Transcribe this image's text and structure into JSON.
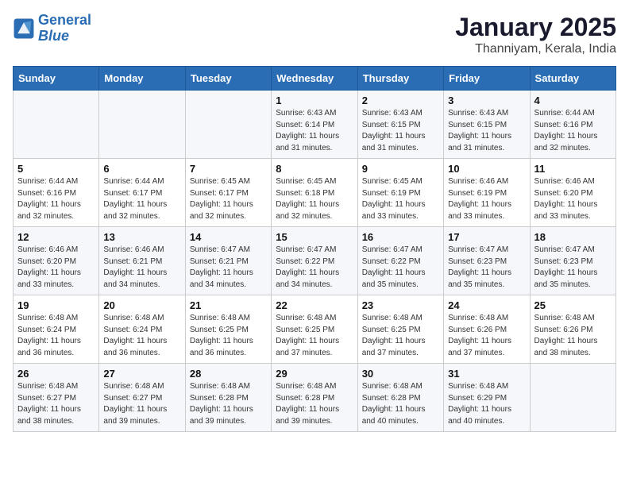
{
  "logo": {
    "line1": "General",
    "line2": "Blue"
  },
  "title": "January 2025",
  "subtitle": "Thanniyam, Kerala, India",
  "days_of_week": [
    "Sunday",
    "Monday",
    "Tuesday",
    "Wednesday",
    "Thursday",
    "Friday",
    "Saturday"
  ],
  "weeks": [
    [
      {
        "day": "",
        "sunrise": "",
        "sunset": "",
        "daylight": ""
      },
      {
        "day": "",
        "sunrise": "",
        "sunset": "",
        "daylight": ""
      },
      {
        "day": "",
        "sunrise": "",
        "sunset": "",
        "daylight": ""
      },
      {
        "day": "1",
        "sunrise": "Sunrise: 6:43 AM",
        "sunset": "Sunset: 6:14 PM",
        "daylight": "Daylight: 11 hours and 31 minutes."
      },
      {
        "day": "2",
        "sunrise": "Sunrise: 6:43 AM",
        "sunset": "Sunset: 6:15 PM",
        "daylight": "Daylight: 11 hours and 31 minutes."
      },
      {
        "day": "3",
        "sunrise": "Sunrise: 6:43 AM",
        "sunset": "Sunset: 6:15 PM",
        "daylight": "Daylight: 11 hours and 31 minutes."
      },
      {
        "day": "4",
        "sunrise": "Sunrise: 6:44 AM",
        "sunset": "Sunset: 6:16 PM",
        "daylight": "Daylight: 11 hours and 32 minutes."
      }
    ],
    [
      {
        "day": "5",
        "sunrise": "Sunrise: 6:44 AM",
        "sunset": "Sunset: 6:16 PM",
        "daylight": "Daylight: 11 hours and 32 minutes."
      },
      {
        "day": "6",
        "sunrise": "Sunrise: 6:44 AM",
        "sunset": "Sunset: 6:17 PM",
        "daylight": "Daylight: 11 hours and 32 minutes."
      },
      {
        "day": "7",
        "sunrise": "Sunrise: 6:45 AM",
        "sunset": "Sunset: 6:17 PM",
        "daylight": "Daylight: 11 hours and 32 minutes."
      },
      {
        "day": "8",
        "sunrise": "Sunrise: 6:45 AM",
        "sunset": "Sunset: 6:18 PM",
        "daylight": "Daylight: 11 hours and 32 minutes."
      },
      {
        "day": "9",
        "sunrise": "Sunrise: 6:45 AM",
        "sunset": "Sunset: 6:19 PM",
        "daylight": "Daylight: 11 hours and 33 minutes."
      },
      {
        "day": "10",
        "sunrise": "Sunrise: 6:46 AM",
        "sunset": "Sunset: 6:19 PM",
        "daylight": "Daylight: 11 hours and 33 minutes."
      },
      {
        "day": "11",
        "sunrise": "Sunrise: 6:46 AM",
        "sunset": "Sunset: 6:20 PM",
        "daylight": "Daylight: 11 hours and 33 minutes."
      }
    ],
    [
      {
        "day": "12",
        "sunrise": "Sunrise: 6:46 AM",
        "sunset": "Sunset: 6:20 PM",
        "daylight": "Daylight: 11 hours and 33 minutes."
      },
      {
        "day": "13",
        "sunrise": "Sunrise: 6:46 AM",
        "sunset": "Sunset: 6:21 PM",
        "daylight": "Daylight: 11 hours and 34 minutes."
      },
      {
        "day": "14",
        "sunrise": "Sunrise: 6:47 AM",
        "sunset": "Sunset: 6:21 PM",
        "daylight": "Daylight: 11 hours and 34 minutes."
      },
      {
        "day": "15",
        "sunrise": "Sunrise: 6:47 AM",
        "sunset": "Sunset: 6:22 PM",
        "daylight": "Daylight: 11 hours and 34 minutes."
      },
      {
        "day": "16",
        "sunrise": "Sunrise: 6:47 AM",
        "sunset": "Sunset: 6:22 PM",
        "daylight": "Daylight: 11 hours and 35 minutes."
      },
      {
        "day": "17",
        "sunrise": "Sunrise: 6:47 AM",
        "sunset": "Sunset: 6:23 PM",
        "daylight": "Daylight: 11 hours and 35 minutes."
      },
      {
        "day": "18",
        "sunrise": "Sunrise: 6:47 AM",
        "sunset": "Sunset: 6:23 PM",
        "daylight": "Daylight: 11 hours and 35 minutes."
      }
    ],
    [
      {
        "day": "19",
        "sunrise": "Sunrise: 6:48 AM",
        "sunset": "Sunset: 6:24 PM",
        "daylight": "Daylight: 11 hours and 36 minutes."
      },
      {
        "day": "20",
        "sunrise": "Sunrise: 6:48 AM",
        "sunset": "Sunset: 6:24 PM",
        "daylight": "Daylight: 11 hours and 36 minutes."
      },
      {
        "day": "21",
        "sunrise": "Sunrise: 6:48 AM",
        "sunset": "Sunset: 6:25 PM",
        "daylight": "Daylight: 11 hours and 36 minutes."
      },
      {
        "day": "22",
        "sunrise": "Sunrise: 6:48 AM",
        "sunset": "Sunset: 6:25 PM",
        "daylight": "Daylight: 11 hours and 37 minutes."
      },
      {
        "day": "23",
        "sunrise": "Sunrise: 6:48 AM",
        "sunset": "Sunset: 6:25 PM",
        "daylight": "Daylight: 11 hours and 37 minutes."
      },
      {
        "day": "24",
        "sunrise": "Sunrise: 6:48 AM",
        "sunset": "Sunset: 6:26 PM",
        "daylight": "Daylight: 11 hours and 37 minutes."
      },
      {
        "day": "25",
        "sunrise": "Sunrise: 6:48 AM",
        "sunset": "Sunset: 6:26 PM",
        "daylight": "Daylight: 11 hours and 38 minutes."
      }
    ],
    [
      {
        "day": "26",
        "sunrise": "Sunrise: 6:48 AM",
        "sunset": "Sunset: 6:27 PM",
        "daylight": "Daylight: 11 hours and 38 minutes."
      },
      {
        "day": "27",
        "sunrise": "Sunrise: 6:48 AM",
        "sunset": "Sunset: 6:27 PM",
        "daylight": "Daylight: 11 hours and 39 minutes."
      },
      {
        "day": "28",
        "sunrise": "Sunrise: 6:48 AM",
        "sunset": "Sunset: 6:28 PM",
        "daylight": "Daylight: 11 hours and 39 minutes."
      },
      {
        "day": "29",
        "sunrise": "Sunrise: 6:48 AM",
        "sunset": "Sunset: 6:28 PM",
        "daylight": "Daylight: 11 hours and 39 minutes."
      },
      {
        "day": "30",
        "sunrise": "Sunrise: 6:48 AM",
        "sunset": "Sunset: 6:28 PM",
        "daylight": "Daylight: 11 hours and 40 minutes."
      },
      {
        "day": "31",
        "sunrise": "Sunrise: 6:48 AM",
        "sunset": "Sunset: 6:29 PM",
        "daylight": "Daylight: 11 hours and 40 minutes."
      },
      {
        "day": "",
        "sunrise": "",
        "sunset": "",
        "daylight": ""
      }
    ]
  ]
}
